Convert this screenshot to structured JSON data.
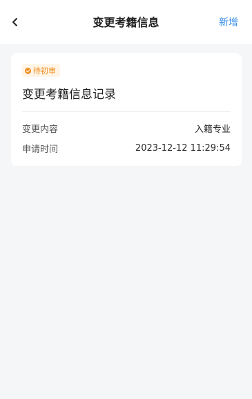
{
  "header": {
    "title": "变更考籍信息",
    "action_label": "新增",
    "back_icon": "chevron-left-icon"
  },
  "record": {
    "status": "待初审",
    "status_color": "#f08c1d",
    "title": "变更考籍信息记录",
    "fields": [
      {
        "label": "变更内容",
        "value": "入籍专业"
      },
      {
        "label": "申请时间",
        "value": "2023-12-12 11:29:54"
      }
    ]
  },
  "colors": {
    "accent": "#3a8ee6",
    "background": "#f5f6f8",
    "card": "#ffffff"
  }
}
